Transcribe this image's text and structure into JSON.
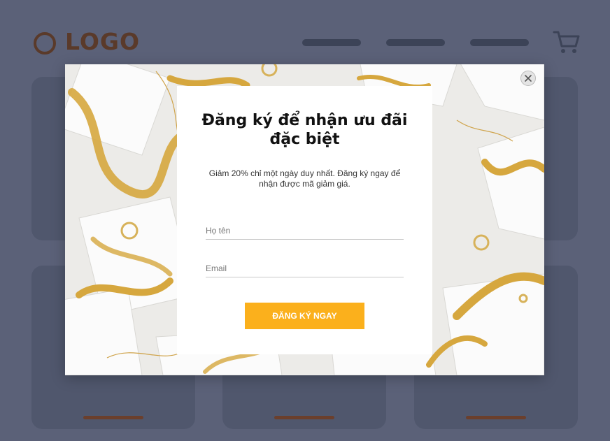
{
  "header": {
    "logo_text": "LOGO",
    "nav_items": [
      "",
      "",
      ""
    ]
  },
  "icons": {
    "logo": "ring-logo-icon",
    "cart": "shopping-cart-icon",
    "close": "close-icon"
  },
  "popup": {
    "title": "Đăng ký để nhận ưu đãi đặc biệt",
    "description": "Giảm 20% chỉ một ngày duy nhất. Đăng ký ngay để nhận được mã giảm giá.",
    "name_placeholder": "Họ tên",
    "email_placeholder": "Email",
    "submit_label": "ĐĂNG KÝ NGAY"
  },
  "colors": {
    "backdrop": "#5b6178",
    "logo": "#5a3a2a",
    "accent": "#fbb01c",
    "gold": "#d6a73e"
  }
}
